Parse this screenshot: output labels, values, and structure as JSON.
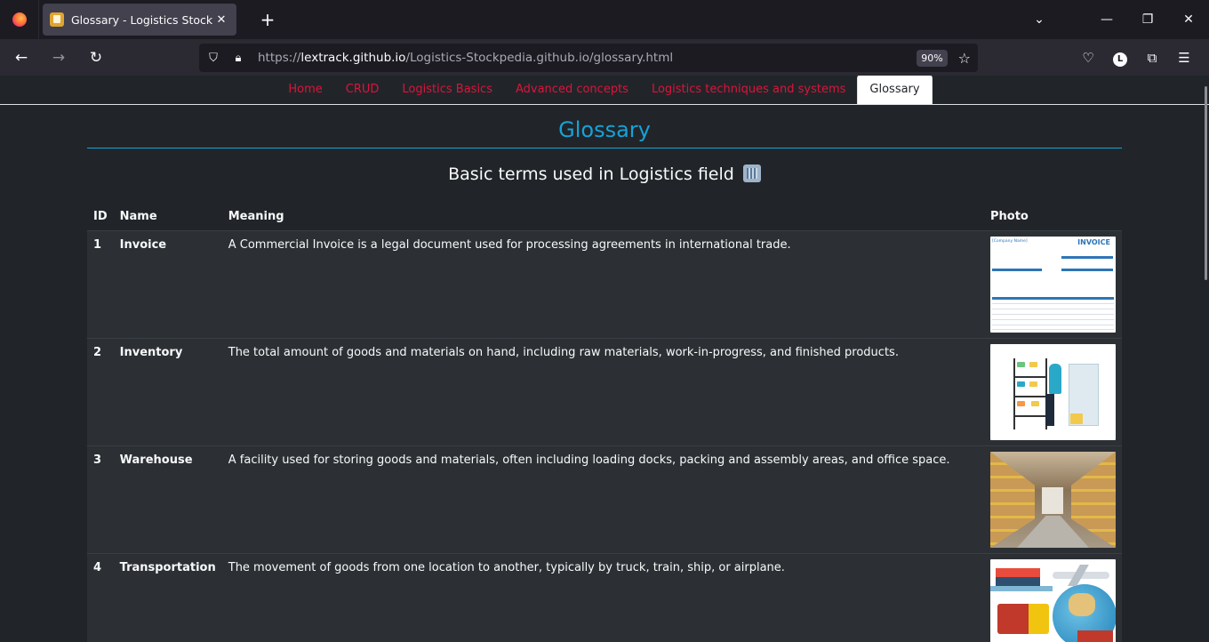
{
  "browser": {
    "tab_title": "Glossary - Logistics Stockpedia",
    "url_prefix": "https://",
    "url_host": "lextrack.github.io",
    "url_path": "/Logistics-Stockpedia.github.io/glossary.html",
    "zoom": "90%",
    "avatar_letter": "L"
  },
  "nav": {
    "items": [
      {
        "label": "Home",
        "active": false
      },
      {
        "label": "CRUD",
        "active": false
      },
      {
        "label": "Logistics Basics",
        "active": false
      },
      {
        "label": "Advanced concepts",
        "active": false
      },
      {
        "label": "Logistics techniques and systems",
        "active": false
      },
      {
        "label": "Glossary",
        "active": true
      }
    ]
  },
  "page": {
    "title": "Glossary",
    "subtitle": "Basic terms used in Logistics field"
  },
  "table": {
    "headers": {
      "id": "ID",
      "name": "Name",
      "meaning": "Meaning",
      "photo": "Photo"
    },
    "rows": [
      {
        "id": "1",
        "name": "Invoice",
        "meaning": "A Commercial Invoice is a legal document used for processing agreements in international trade.",
        "photo": "invoice-image"
      },
      {
        "id": "2",
        "name": "Inventory",
        "meaning": "The total amount of goods and materials on hand, including raw materials, work-in-progress, and finished products.",
        "photo": "inventory-image"
      },
      {
        "id": "3",
        "name": "Warehouse",
        "meaning": "A facility used for storing goods and materials, often including loading docks, packing and assembly areas, and office space.",
        "photo": "warehouse-image"
      },
      {
        "id": "4",
        "name": "Transportation",
        "meaning": "The movement of goods from one location to another, typically by truck, train, ship, or airplane.",
        "photo": "transportation-image"
      }
    ]
  },
  "invoice_image": {
    "heading": "INVOICE",
    "company": "[Company Name]"
  },
  "colors": {
    "nav_link": "#dc143c",
    "title_accent": "#17a2d8",
    "page_bg": "#212529"
  }
}
